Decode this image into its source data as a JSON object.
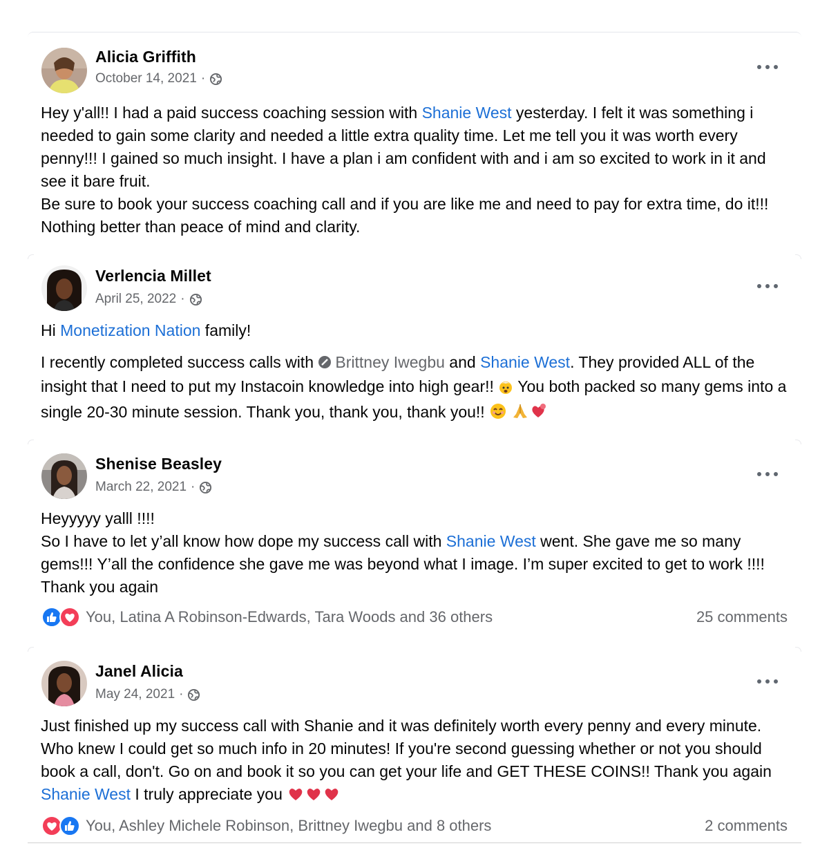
{
  "posts": [
    {
      "author": "Alicia Griffith",
      "date": "October 14, 2021",
      "body": {
        "l1_a": "Hey y'all!!  I had a paid success coaching session with ",
        "l1_link": "Shanie West",
        "l1_b": " yesterday.  I felt it was something i needed to gain some clarity and needed a little extra quality time. Let me tell you it was worth every penny!!! I gained so much insight.  I have a plan i am confident with and i am so excited to work in it and see it bare fruit.",
        "l2": "Be sure to book your success coaching call and if you are like me and need to pay for extra time, do it!!! Nothing better than peace of   mind and clarity."
      }
    },
    {
      "author": "Verlencia Millet",
      "date": "April 25, 2022",
      "body": {
        "p1_a": "Hi ",
        "p1_link": "Monetization Nation",
        "p1_b": " family!",
        "p2_a": "I recently completed success calls with ",
        "p2_mention": "Brittney Iwegbu",
        "p2_b": " and ",
        "p2_link": "Shanie West",
        "p2_c": ". They provided ALL of the insight that I need to put my Instacoin knowledge into high gear!! ",
        "p2_d": " You both packed so many gems into a single 20-30 minute session. Thank you, thank you, thank you!! "
      }
    },
    {
      "author": "Shenise Beasley",
      "date": "March 22, 2021",
      "body": {
        "l1": "Heyyyyy yalll !!!!",
        "l2_a": "So I have to let y’all know how dope my success call with ",
        "l2_link": "Shanie West",
        "l2_b": "  went. She gave me so many gems!!! Y’all the confidence she gave me was beyond what I image. I’m super excited to get to work !!!! Thank you again"
      },
      "reactions": "You, Latina A Robinson-Edwards, Tara Woods and 36 others",
      "comments": "25 comments"
    },
    {
      "author": "Janel Alicia",
      "date": "May 24, 2021",
      "body": {
        "a": "Just finished up my success call with Shanie and it was definitely worth every penny and every minute.  Who knew I could get so much info in 20 minutes!  If you're second guessing whether or not you should book a call, don't. Go on and book it so you can get your life and GET THESE COINS!!  Thank you again ",
        "link": "Shanie West",
        "b": " I truly appreciate you "
      },
      "reactions": "You, Ashley Michele Robinson, Brittney Iwegbu and 8 others",
      "comments": "2 comments"
    }
  ],
  "icons": {
    "privacy": "globe-icon",
    "more": "more-options-icon",
    "like": "like-reaction-icon",
    "love": "love-reaction-icon",
    "verified": "verified-badge-icon"
  },
  "colors": {
    "link": "#1c6fd6",
    "secondary_text": "#65676b",
    "like_blue": "#1877f2",
    "love_red": "#f33e58"
  }
}
